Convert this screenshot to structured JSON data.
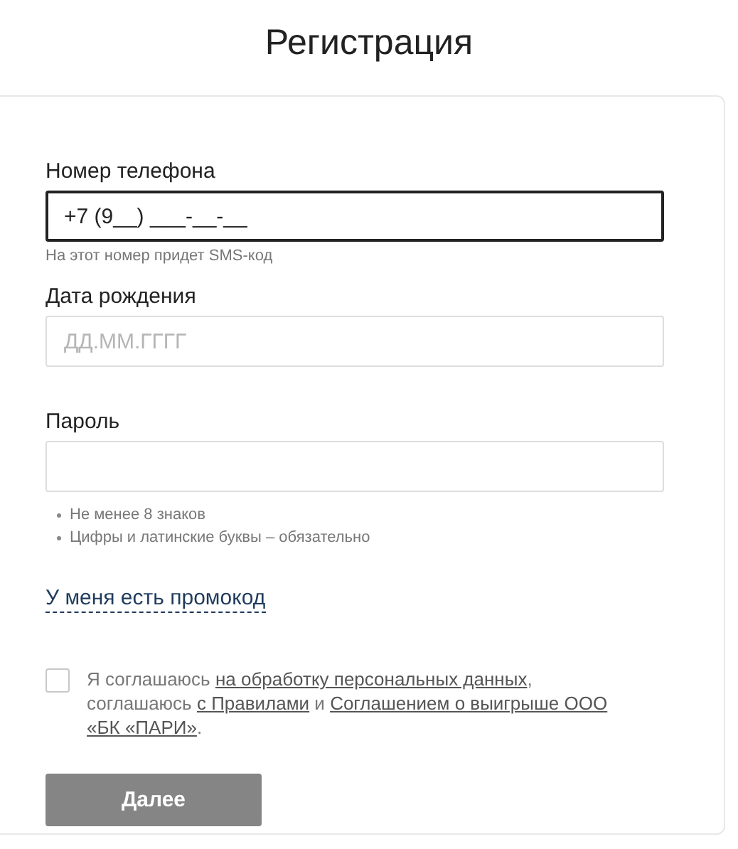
{
  "title": "Регистрация",
  "fields": [
    {
      "label": "Номер телефона",
      "value": "+7 (9__) ___-__-__",
      "focused": true,
      "hint": "На этот номер придет SMS-код"
    },
    {
      "label": "Дата рождения",
      "placeholder": "ДД.ММ.ГГГГ",
      "focused": false
    },
    {
      "label": "Пароль",
      "focused": false,
      "rules": [
        "Не менее 8 знаков",
        "Цифры и латинские буквы – обязательно"
      ]
    }
  ],
  "promo_link": "У меня есть промокод",
  "consent": {
    "checked": false,
    "parts": [
      {
        "kind": "text",
        "text": "Я соглашаюсь "
      },
      {
        "kind": "link",
        "text": "на обработку персональных данных"
      },
      {
        "kind": "text",
        "text": ", соглашаюсь "
      },
      {
        "kind": "link",
        "text": "с Правилами"
      },
      {
        "kind": "text",
        "text": " и "
      },
      {
        "kind": "link",
        "text": "Соглашением о выигрыше ООО"
      },
      {
        "kind": "link",
        "text": "«БК «ПАРИ»"
      },
      {
        "kind": "text",
        "text": "."
      }
    ]
  },
  "submit": {
    "label": "Далее",
    "disabled": true
  }
}
